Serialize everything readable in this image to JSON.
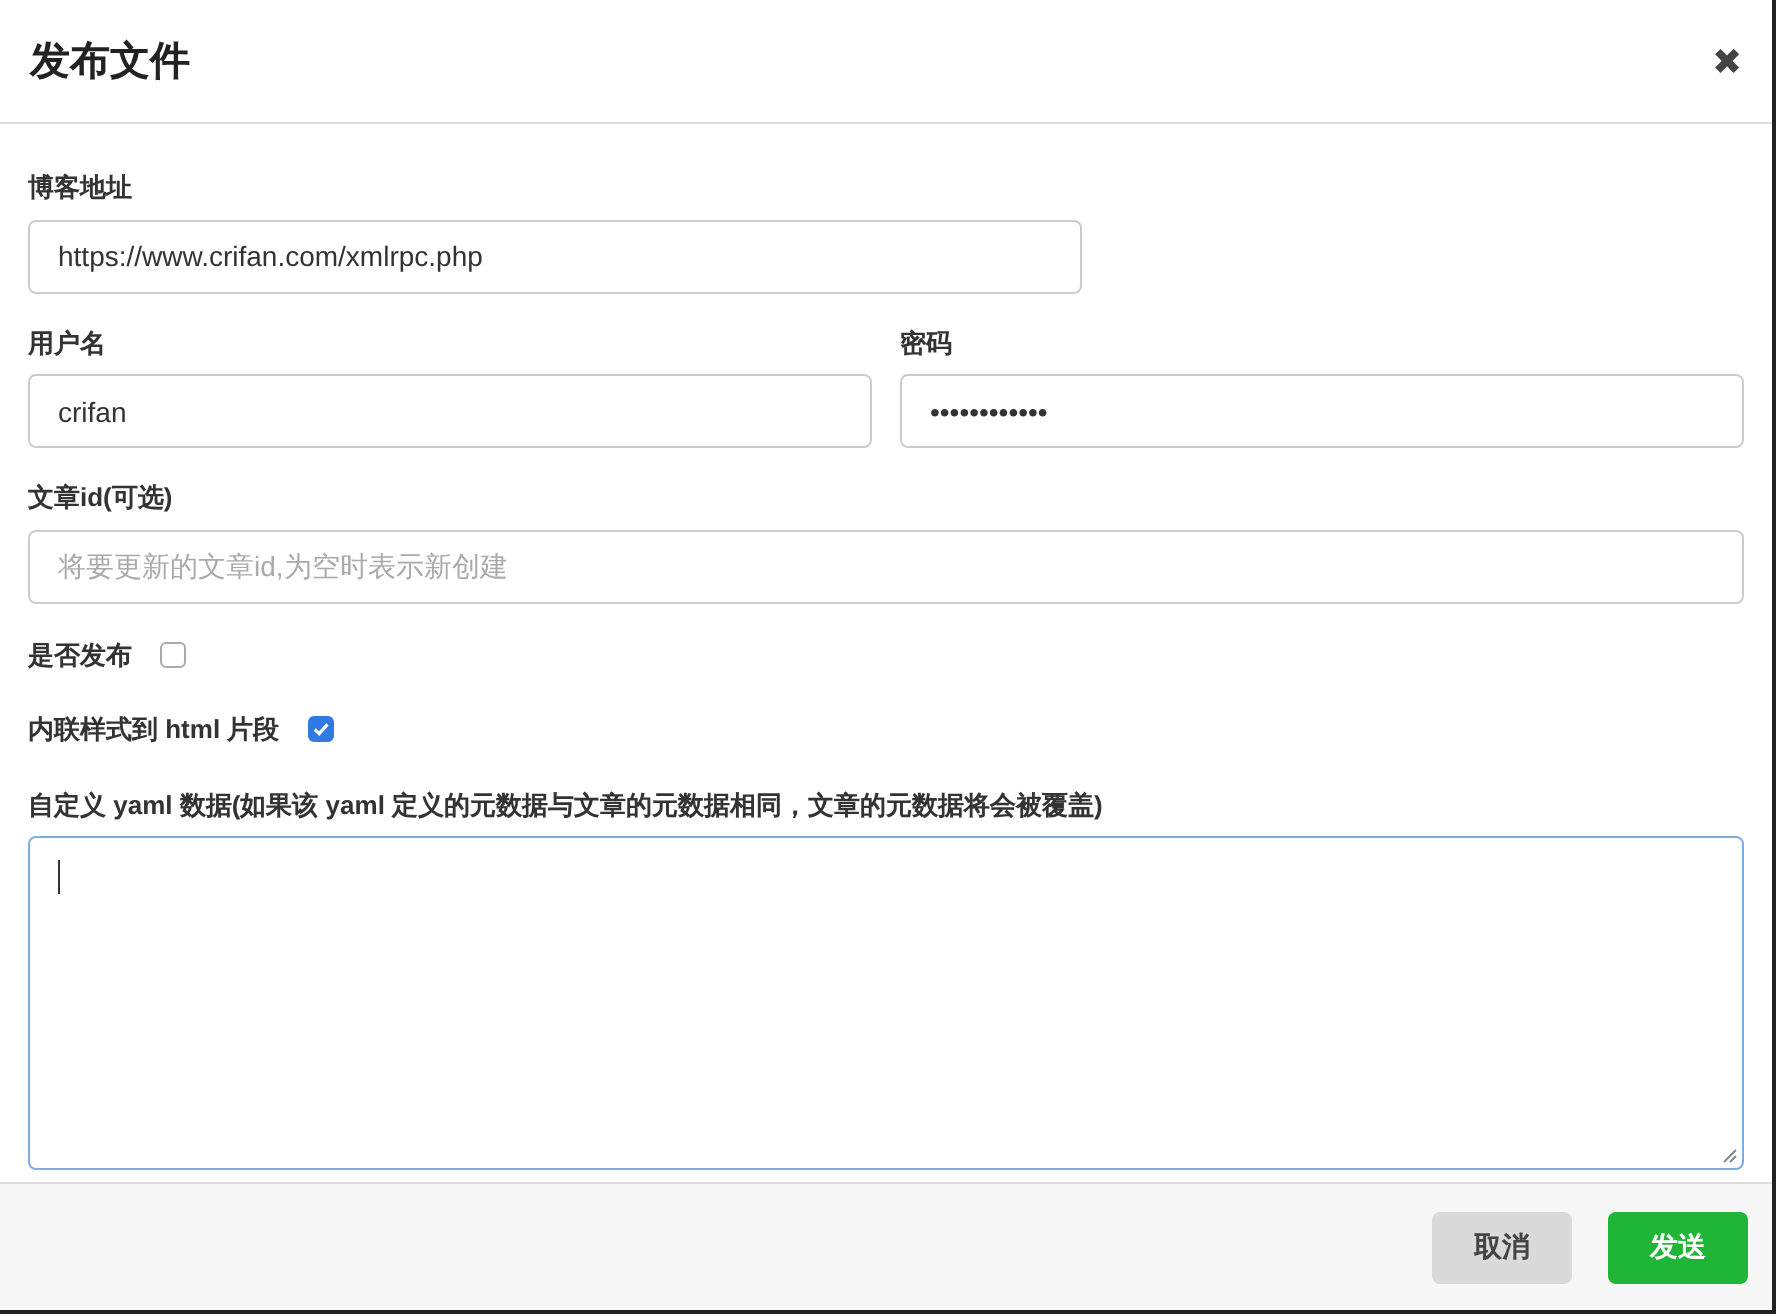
{
  "dialog": {
    "title": "发布文件",
    "close": "✖"
  },
  "fields": {
    "blog_url": {
      "label": "博客地址",
      "value": "https://www.crifan.com/xmlrpc.php"
    },
    "username": {
      "label": "用户名",
      "value": "crifan"
    },
    "password": {
      "label": "密码",
      "value": "••••••••••••"
    },
    "post_id": {
      "label": "文章id(可选)",
      "placeholder": "将要更新的文章id,为空时表示新创建"
    },
    "publish": {
      "label": "是否发布",
      "checked": false
    },
    "inline_css": {
      "label": "内联样式到 html 片段",
      "checked": true
    },
    "yaml": {
      "label": "自定义 yaml 数据(如果该 yaml 定义的元数据与文章的元数据相同，文章的元数据将会被覆盖)",
      "focused": true
    }
  },
  "buttons": [
    {
      "label": "取消",
      "kind": "secondary"
    },
    {
      "label": "发送",
      "kind": "primary"
    }
  ]
}
